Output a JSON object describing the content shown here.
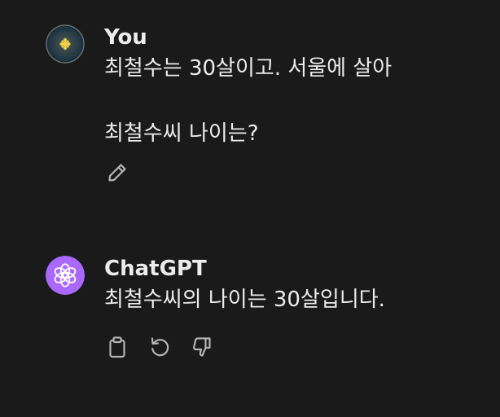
{
  "messages": {
    "user": {
      "author": "You",
      "lines": [
        "최철수는 30살이고. 서울에 살아",
        "",
        "최철수씨 나이는?"
      ],
      "actions": [
        "pencil-icon"
      ]
    },
    "assistant": {
      "author": "ChatGPT",
      "lines": [
        "최철수씨의 나이는 30살입니다."
      ],
      "actions": [
        "clipboard-icon",
        "regenerate-icon",
        "thumbs-down-icon"
      ]
    }
  },
  "colors": {
    "background": "#1a1a1a",
    "text": "#ececec",
    "icon": "#b4b4b4",
    "chatgpt_avatar": "#ab68ff",
    "user_avatar": "#1f3442"
  }
}
